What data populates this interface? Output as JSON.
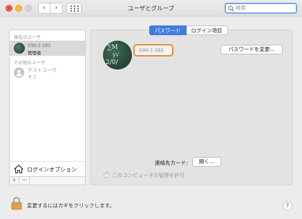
{
  "window": {
    "title": "ユーザとグループ",
    "search_placeholder": "検索",
    "nav_back": "‹",
    "nav_forward": "›"
  },
  "sidebar": {
    "current_user_section": "現在のユーザ",
    "current_user": {
      "name": "030-1-161",
      "role": "管理者"
    },
    "other_users_section": "その他のユーザ",
    "guest_user": {
      "name": "ゲストユーザ",
      "status": "オフ"
    },
    "login_options_label": "ログインオプション",
    "add_label": "+",
    "remove_label": "−"
  },
  "panel": {
    "tabs": [
      {
        "label": "パスワード",
        "active": true
      },
      {
        "label": "ログイン項目",
        "active": false
      }
    ],
    "user_name": "030-1-161",
    "change_password_label": "パスワードを変更...",
    "contact_card_label": "連絡先カード:",
    "open_button_label": "開く...",
    "allow_admin_label": "このコンピュータの管理を許可"
  },
  "footer": {
    "lock_text": "変更するにはカギをクリックします。",
    "help_label": "?"
  },
  "colors": {
    "accent": "#3f7ee4",
    "focus_ring": "#e58c2e"
  }
}
